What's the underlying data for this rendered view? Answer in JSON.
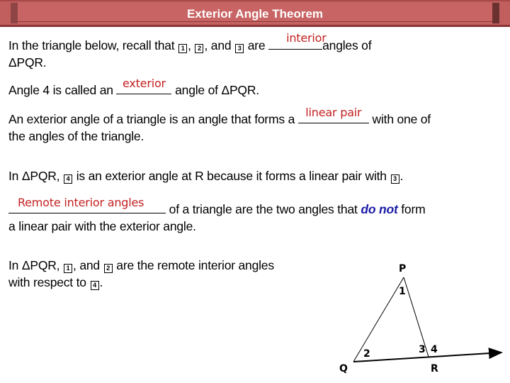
{
  "header": {
    "title": "Exterior Angle Theorem"
  },
  "colors": {
    "header_bg": "#c96464",
    "answer_text": "#c41f1f",
    "emphasis_text": "#1a1aa6"
  },
  "paragraphs": {
    "p1": {
      "before": "In the triangle below, recall that",
      "box1": "1",
      "sep1": ",",
      "box2": "2",
      "sep2": ", and",
      "box3": "3",
      "are": "are",
      "answer": "interior",
      "after": "angles of",
      "line2": "ΔPQR."
    },
    "p2": {
      "before": "Angle 4 is called an",
      "answer": "exterior",
      "after": "angle of ΔPQR."
    },
    "p3": {
      "before": "An exterior angle of a triangle is an angle that forms a",
      "answer": "linear pair",
      "after": "with one of",
      "line2": "the angles of the triangle."
    },
    "p4": {
      "before": "In ΔPQR,",
      "box4": "4",
      "middle": "is an exterior angle at R because it forms a linear pair with",
      "box3": "3",
      "end": "."
    },
    "p5": {
      "answer": "Remote interior angles",
      "after": "of a triangle are the two angles that",
      "emphasis": "do not",
      "after2": "form",
      "line2": "a linear pair with the exterior angle."
    },
    "p6": {
      "before": "In ΔPQR,",
      "box1": "1",
      "sep1": ", and",
      "box2": "2",
      "middle": "are the remote interior angles",
      "line2_before": "with respect to",
      "box4": "4",
      "end": "."
    }
  },
  "diagram": {
    "vertices": {
      "P": "P",
      "Q": "Q",
      "R": "R"
    },
    "angles": {
      "a1": "1",
      "a2": "2",
      "a3": "3",
      "a4": "4"
    }
  }
}
